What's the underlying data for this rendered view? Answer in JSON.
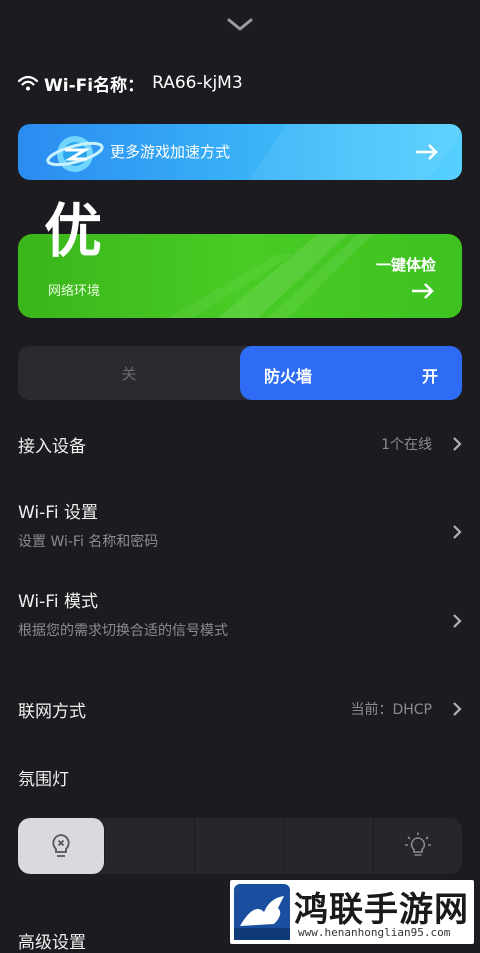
{
  "header": {
    "collapse_icon": "chevron-down-icon"
  },
  "wifi": {
    "icon": "wifi-icon",
    "label": "Wi-Fi名称：",
    "ssid": "RA66-kjM3"
  },
  "game_banner": {
    "label": "更多游戏加速方式",
    "icon": "globe-icon",
    "arrow": "arrow-right-icon",
    "colors": {
      "start": "#2a8bf0",
      "end": "#55d0ff"
    }
  },
  "network_banner": {
    "grade": "优",
    "caption": "网络环境",
    "action": "一键体检",
    "arrow": "arrow-right-icon",
    "colors": {
      "start": "#3ab51a",
      "end": "#49cc25"
    }
  },
  "firewall": {
    "off_label": "关",
    "name": "防火墙",
    "on_label": "开",
    "state": "on",
    "accent": "#2f6cf5"
  },
  "settings": {
    "devices": {
      "title": "接入设备",
      "value": "1个在线"
    },
    "wifi_settings": {
      "title": "Wi-Fi 设置",
      "subtitle": "设置 Wi-Fi 名称和密码"
    },
    "wifi_mode": {
      "title": "Wi-Fi 模式",
      "subtitle": "根据您的需求切换合适的信号模式"
    },
    "connection": {
      "title": "联网方式",
      "value": "当前：DHCP"
    },
    "ambient_light": {
      "title": "氛围灯"
    },
    "advanced": {
      "title": "高级设置"
    }
  },
  "ambient_levels": {
    "icons": [
      "light-off-icon",
      "light-on-icon"
    ],
    "selected_index": 0,
    "segments": 5
  },
  "watermark": {
    "title": "鸿联手游网",
    "url": "www.henanhonglian95.com"
  }
}
